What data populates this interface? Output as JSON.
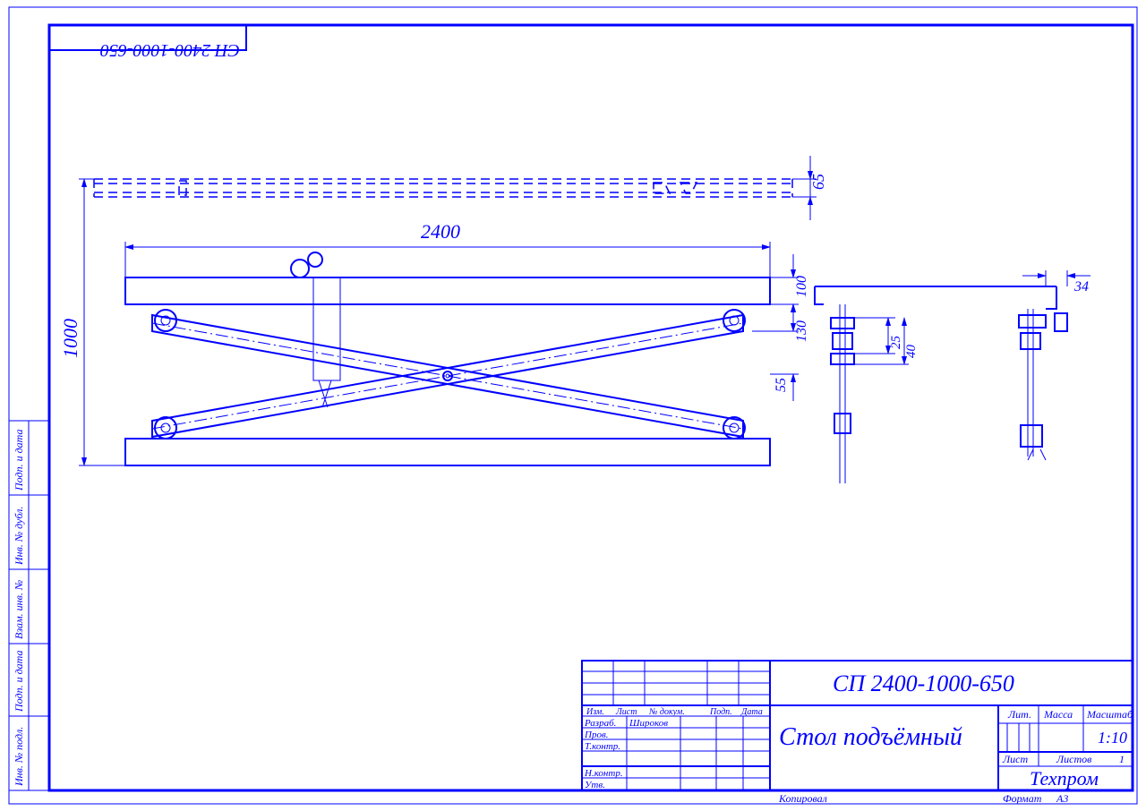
{
  "doc_number": "СП 2400-1000-650",
  "title": "Стол подъёмный",
  "company": "Техпром",
  "scale": "1:10",
  "sheets_total": "1",
  "format": "А3",
  "dims": {
    "width": "2400",
    "height": "1000",
    "top_thickness": "65",
    "platform_mid": "100",
    "platform_lower": "130",
    "detail_outer": "55",
    "detail_mid": "40",
    "detail_inner": "25",
    "side_width": "34"
  },
  "tb": {
    "hdr_izm": "Изм.",
    "hdr_list": "Лист",
    "hdr_docnum": "№ докум.",
    "hdr_podp": "Подп.",
    "hdr_data": "Дата",
    "r_razrab": "Разраб.",
    "r_prov": "Пров.",
    "r_tkontr": "Т.контр.",
    "r_nkontr": "Н.контр.",
    "r_utv": "Утв.",
    "dev_name": "Широков",
    "lit": "Лит.",
    "massa": "Масса",
    "masshtab": "Масштаб",
    "list": "Лист",
    "listov": "Листов",
    "kopiroval": "Копировал",
    "format_lbl": "Формат"
  },
  "sidebar": {
    "s1": "Инв. № подл.",
    "s2": "Подп. и дата",
    "s3": "Взам. инв. №",
    "s4": "Инв. № дубл.",
    "s5": "Подп. и дата"
  }
}
